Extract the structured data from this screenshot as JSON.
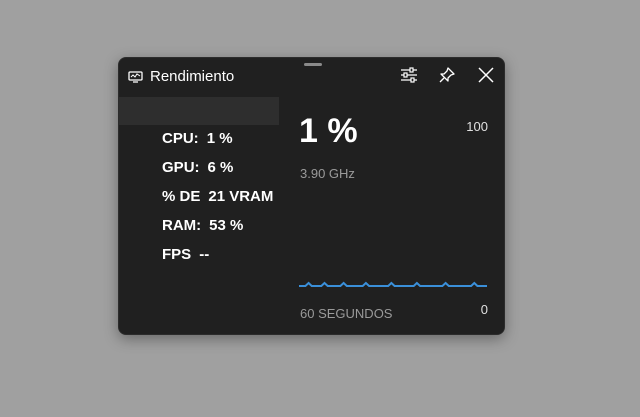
{
  "window": {
    "title": "Rendimiento",
    "icons": {
      "title": "monitor-icon",
      "settings": "sliders-icon",
      "pin": "pin-icon",
      "close": "close-icon"
    }
  },
  "sidebar": {
    "items": [
      {
        "label": "CPU:",
        "value": "1 %",
        "selected": true
      },
      {
        "label": "GPU:",
        "value": "6 %",
        "selected": false
      },
      {
        "label": "% DE",
        "value": "21 VRAM",
        "selected": false
      },
      {
        "label": "RAM:",
        "value": "53 %",
        "selected": false
      },
      {
        "label": "FPS",
        "value": "--",
        "selected": false
      }
    ]
  },
  "panel": {
    "value": "1 %",
    "frequency": "3.90 GHz",
    "max": "100",
    "min": "0",
    "period": "60 SEGUNDOS"
  },
  "colors": {
    "background": "#a0a0a0",
    "widget": "#202020",
    "selected": "#2e2e2e",
    "graph_line": "#3a8fd9",
    "muted_text": "#9a9a9a"
  },
  "chart_data": {
    "type": "line",
    "ylim": [
      0,
      100
    ],
    "values": [
      1,
      1,
      1,
      2,
      1,
      1,
      1,
      1,
      2,
      1,
      1,
      1,
      1,
      1,
      2,
      1,
      1,
      1,
      1,
      1,
      1,
      2,
      1,
      1,
      1,
      1,
      1,
      1,
      1,
      2,
      1,
      1,
      1,
      1,
      1,
      1,
      1,
      2,
      1,
      1,
      1,
      1,
      1,
      1,
      1,
      1,
      2,
      1,
      1,
      1,
      1,
      1,
      1,
      1,
      1,
      2,
      1,
      1,
      1,
      1
    ]
  }
}
